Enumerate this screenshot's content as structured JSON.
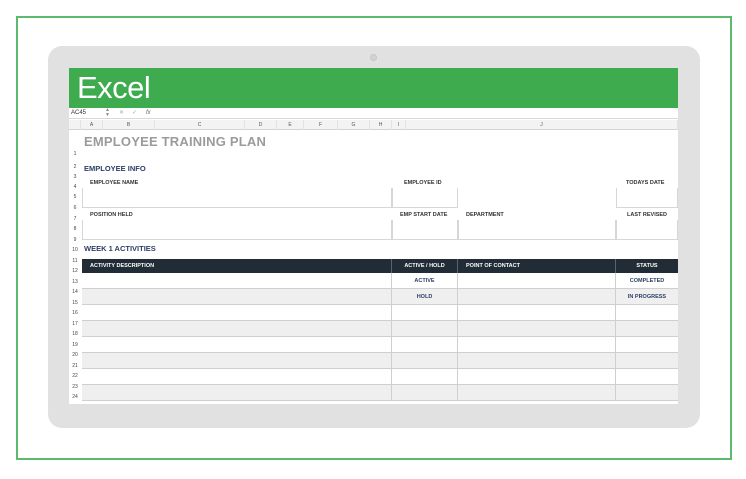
{
  "app": {
    "title": "Excel"
  },
  "formula_bar": {
    "namebox": "AC45",
    "fx": "fx",
    "cancel": "✕",
    "confirm": "✓"
  },
  "columns": [
    "A",
    "B",
    "C",
    "D",
    "E",
    "F",
    "G",
    "H",
    "I",
    "J"
  ],
  "rows": [
    "1",
    "2",
    "3",
    "4",
    "5",
    "6",
    "7",
    "8",
    "9",
    "10",
    "11",
    "12",
    "13",
    "14",
    "15",
    "16",
    "17",
    "18",
    "19",
    "20",
    "21",
    "22",
    "23",
    "24",
    "25"
  ],
  "sheet": {
    "title": "EMPLOYEE TRAINING PLAN",
    "employee_info": {
      "heading": "EMPLOYEE INFO",
      "employee_name": "EMPLOYEE NAME",
      "employee_id": "EMPLOYEE ID",
      "todays_date": "TODAYS DATE",
      "position_held": "POSITION HELD",
      "emp_start_date": "EMP START DATE",
      "department": "DEPARTMENT",
      "last_revised": "LAST REVISED"
    },
    "week1": {
      "heading": "WEEK 1 ACTIVITIES",
      "headers": [
        "ACTIVITY DESCRIPTION",
        "ACTIVE / HOLD",
        "POINT OF CONTACT",
        "STATUS"
      ],
      "rows": [
        [
          "",
          "ACTIVE",
          "",
          "COMPLETED"
        ],
        [
          "",
          "HOLD",
          "",
          "IN PROGRESS"
        ],
        [
          "",
          "",
          "",
          ""
        ],
        [
          "",
          "",
          "",
          ""
        ],
        [
          "",
          "",
          "",
          ""
        ],
        [
          "",
          "",
          "",
          ""
        ],
        [
          "",
          "",
          "",
          ""
        ],
        [
          "",
          "",
          "",
          ""
        ]
      ]
    }
  },
  "colors": {
    "ribbon": "#3eac4e",
    "frame": "#5cb970",
    "table_header": "#222c36",
    "section_text": "#2c3e66"
  }
}
